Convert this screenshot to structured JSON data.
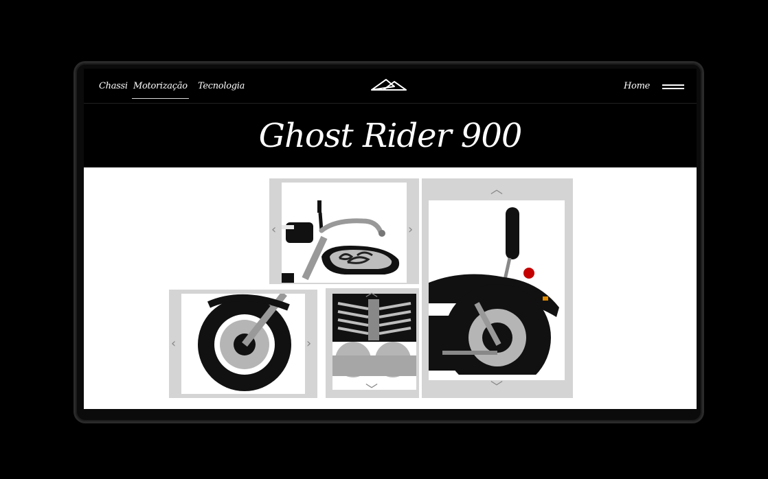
{
  "nav": {
    "links": [
      "Chassi",
      "Motorização",
      "Tecnologia"
    ],
    "active_link": "Motorização",
    "home": "Home"
  },
  "hero": {
    "title": "Ghost Rider 900"
  },
  "icons": {
    "logo": "mountain-logo-icon",
    "menu": "hamburger-menu-icon",
    "arrow_left": "chevron-left-icon",
    "arrow_right": "chevron-right-icon",
    "arrow_up": "chevron-up-icon",
    "arrow_down": "chevron-down-icon"
  },
  "colors": {
    "background": "#000000",
    "text": "#ffffff",
    "tile_frame": "#d4d4d4",
    "gallery_bg": "#ffffff",
    "bike_black": "#111111",
    "bike_chrome": "#a6a6a6"
  }
}
